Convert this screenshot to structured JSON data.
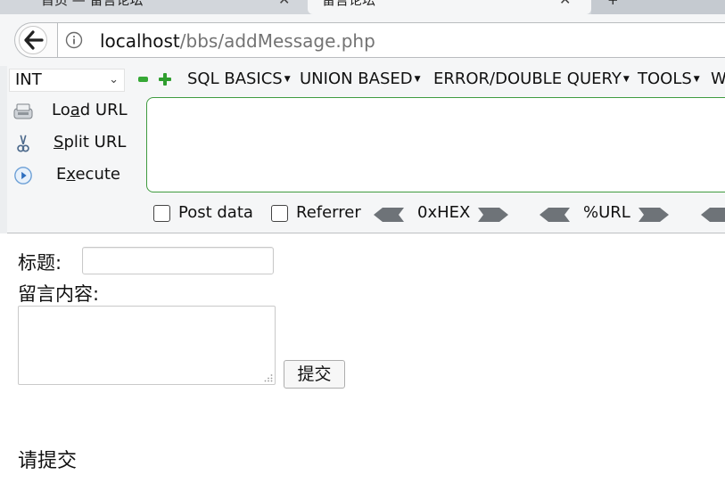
{
  "tabs": [
    {
      "label": "首页 — 留言论坛",
      "close": "✕"
    },
    {
      "label": "留言论坛",
      "close": "✕"
    },
    {
      "label": "+"
    }
  ],
  "address_bar": {
    "host": "localhost",
    "path": "/bbs/addMessage.php"
  },
  "hackbar": {
    "select_value": "INT",
    "menus": [
      "SQL BASICS",
      "UNION BASED",
      "ERROR/DOUBLE QUERY",
      "TOOLS",
      "W"
    ],
    "actions": {
      "load_url": {
        "pre": "Lo",
        "ul": "a",
        "post": "d URL"
      },
      "split_url": {
        "pre": "",
        "ul": "S",
        "post": "plit URL"
      },
      "execute": {
        "pre": "E",
        "ul": "x",
        "post": "ecute"
      }
    },
    "checkboxes": [
      "Post data",
      "Referrer"
    ],
    "encoders": [
      "0xHEX",
      "%URL"
    ]
  },
  "form": {
    "title_label": "标题:",
    "content_label": "留言内容:",
    "submit_label": "提交",
    "status_text": "请提交"
  },
  "colors": {
    "hackbar_border": "#3f9b3f",
    "plus_minus_green": "#36a836",
    "toolbar_bg": "#f5f6f7"
  }
}
